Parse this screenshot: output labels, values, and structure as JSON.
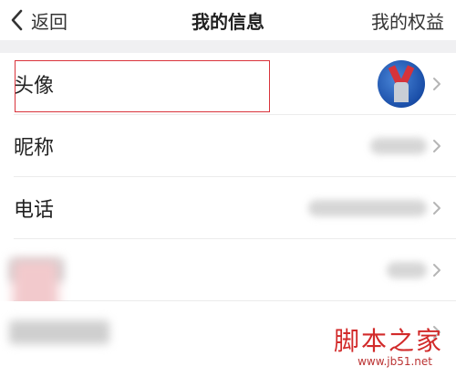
{
  "nav": {
    "back_label": "返回",
    "title": "我的信息",
    "right_label": "我的权益"
  },
  "rows": {
    "avatar_label": "头像",
    "nickname_label": "昵称",
    "phone_label": "电话"
  },
  "watermark": {
    "main": "脚本之家",
    "url": "www.jb51.net"
  },
  "colors": {
    "highlight": "#d9333b",
    "divider": "#ececec",
    "gap": "#f0f0f2"
  }
}
